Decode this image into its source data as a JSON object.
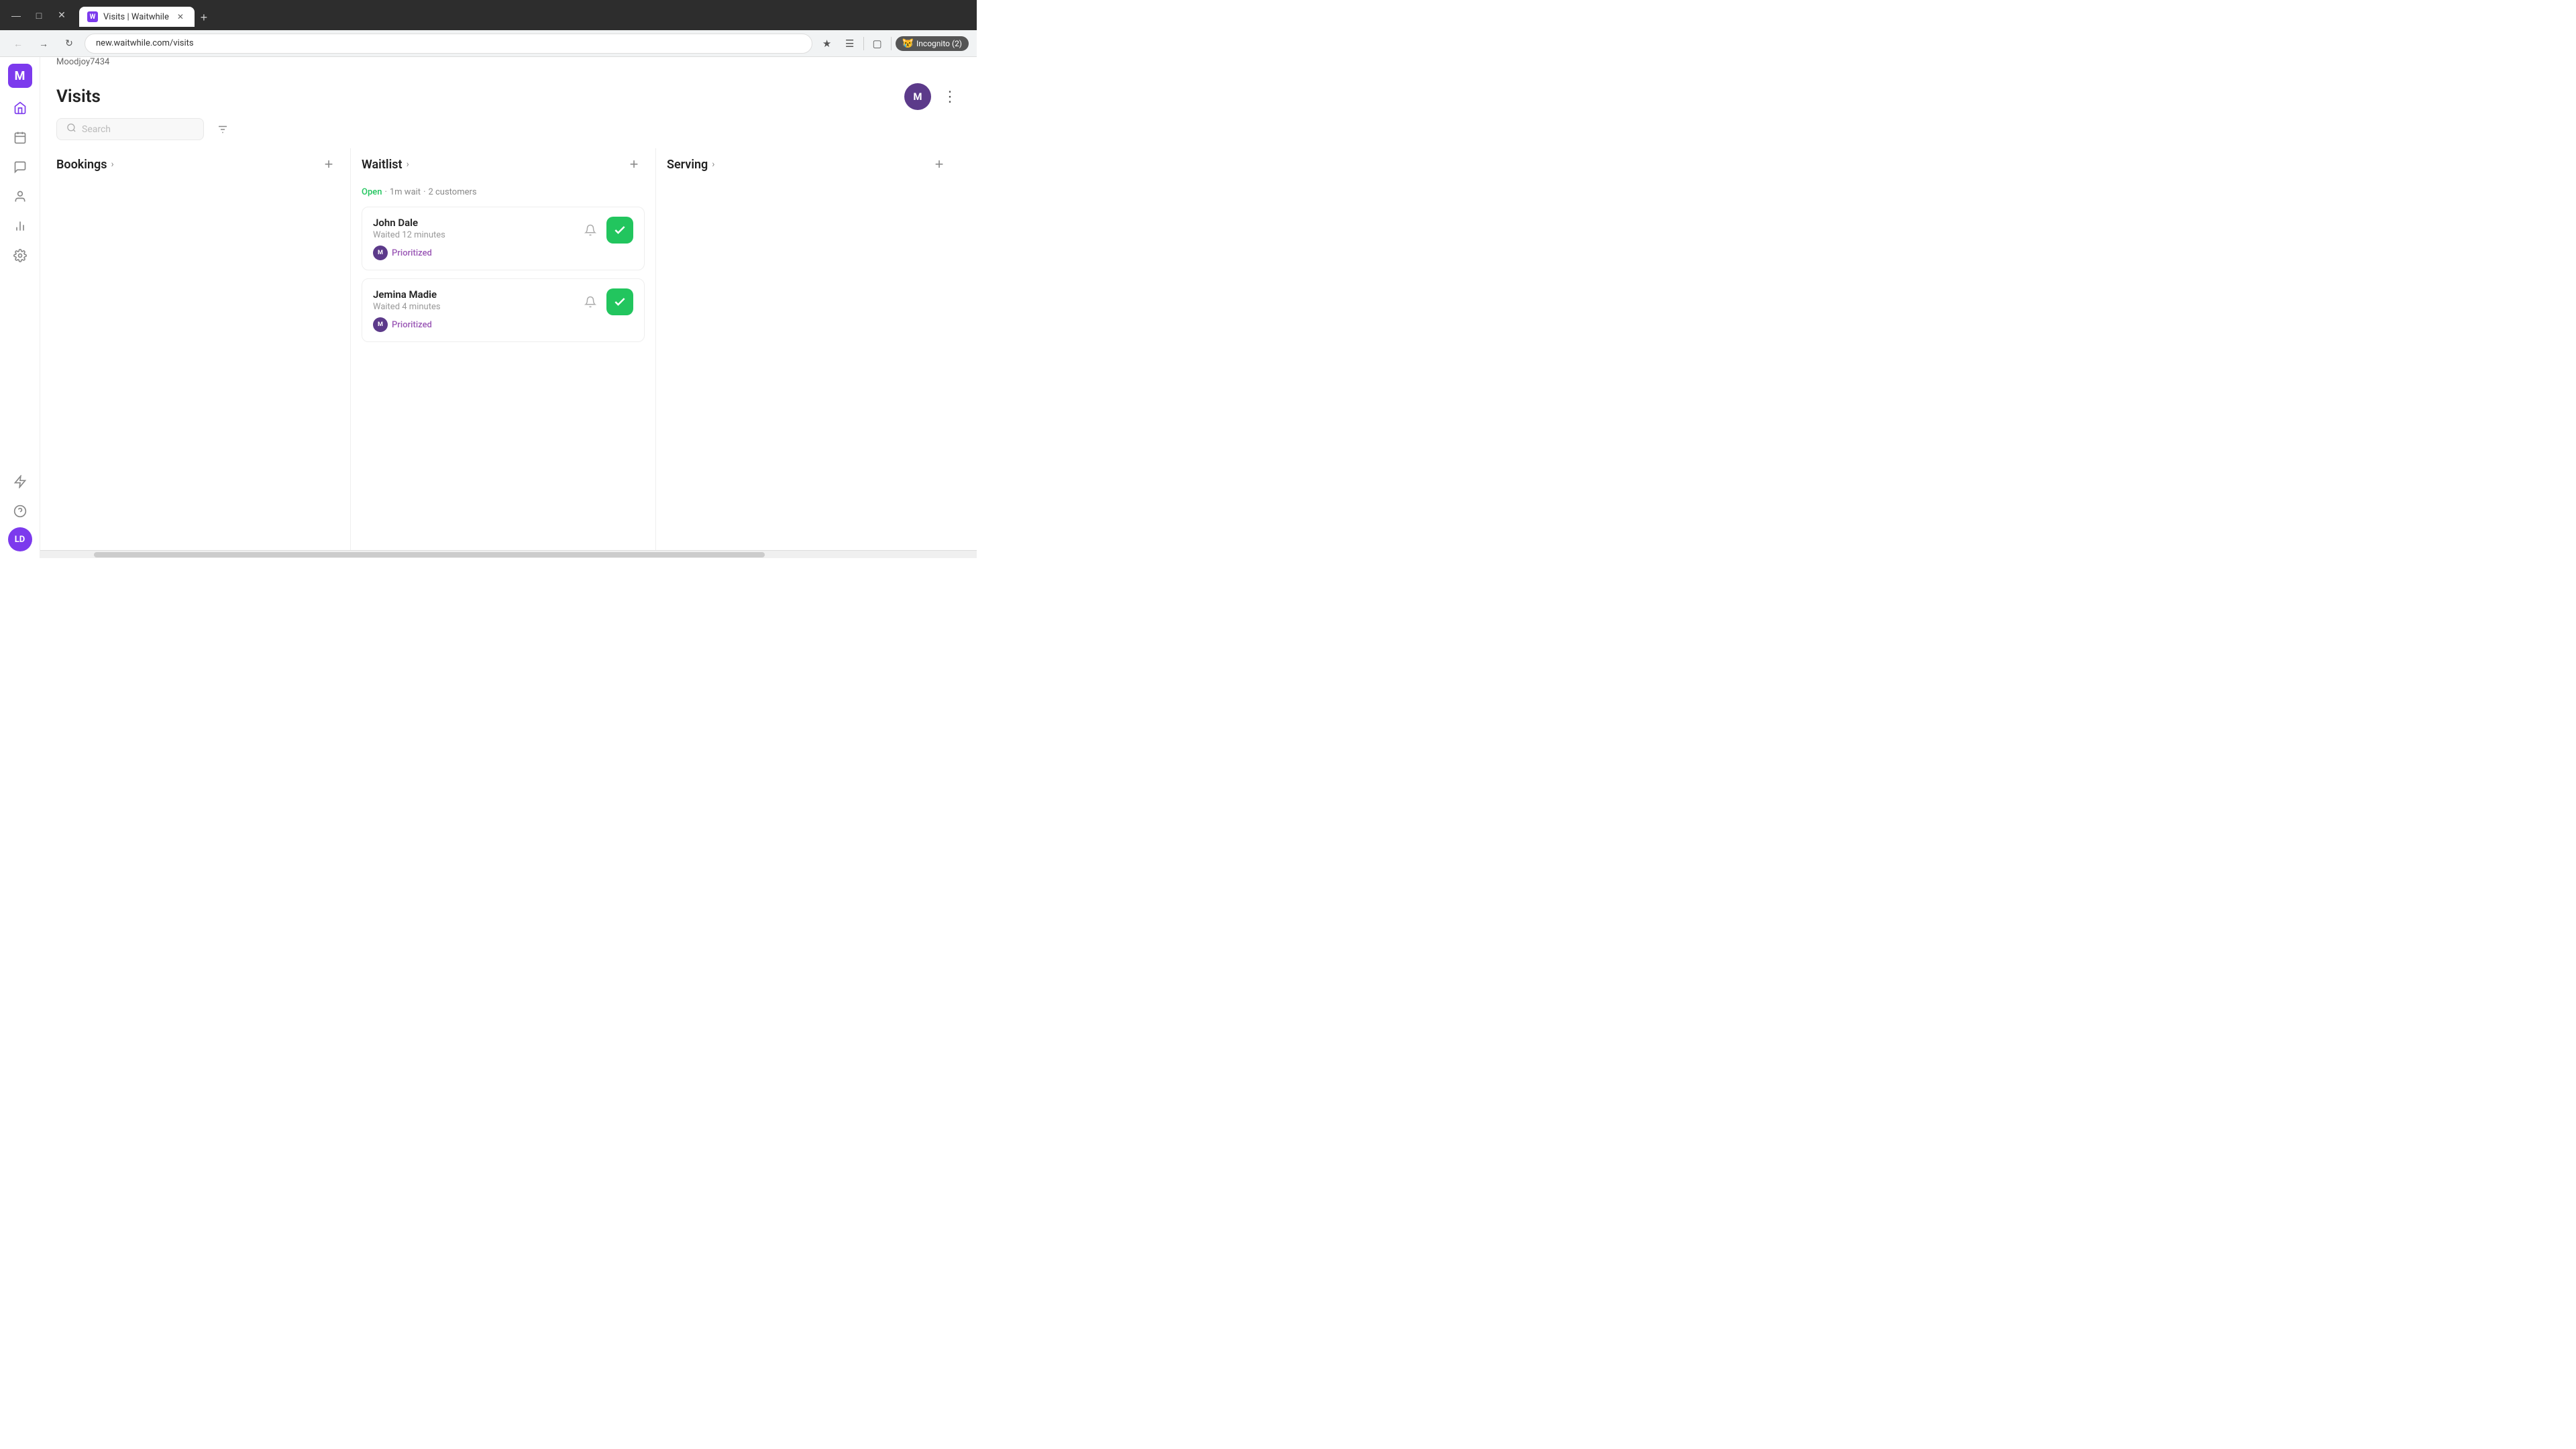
{
  "browser": {
    "tab_title": "Visits | Waitwhile",
    "tab_favicon_letter": "W",
    "url": "new.waitwhile.com/visits",
    "incognito_label": "Incognito (2)",
    "new_tab_label": "+"
  },
  "workspace": {
    "name": "Moodjoy7434",
    "logo_letter": "M"
  },
  "page": {
    "title": "Visits"
  },
  "header": {
    "user_initials": "M",
    "more_label": "⋮"
  },
  "toolbar": {
    "search_placeholder": "Search",
    "filter_icon": "≡"
  },
  "columns": [
    {
      "id": "bookings",
      "title": "Bookings",
      "has_add": true,
      "status_line": null,
      "visits": []
    },
    {
      "id": "waitlist",
      "title": "Waitlist",
      "has_add": true,
      "status_open": "Open",
      "status_wait": "1m wait",
      "status_customers": "2 customers",
      "visits": [
        {
          "name": "John Dale",
          "wait": "Waited 12 minutes",
          "tag_initials": "M",
          "tag_label": "Prioritized"
        },
        {
          "name": "Jemina Madie",
          "wait": "Waited 4 minutes",
          "tag_initials": "M",
          "tag_label": "Prioritized"
        }
      ]
    },
    {
      "id": "serving",
      "title": "Serving",
      "has_add": true,
      "status_line": null,
      "visits": []
    }
  ],
  "sidebar": {
    "items": [
      {
        "id": "home",
        "icon": "⌂",
        "label": "Home"
      },
      {
        "id": "calendar",
        "icon": "📅",
        "label": "Calendar"
      },
      {
        "id": "chat",
        "icon": "💬",
        "label": "Messages"
      },
      {
        "id": "users",
        "icon": "👤",
        "label": "Users"
      },
      {
        "id": "analytics",
        "icon": "📊",
        "label": "Analytics"
      },
      {
        "id": "settings",
        "icon": "⚙",
        "label": "Settings"
      }
    ],
    "bottom": [
      {
        "id": "flash",
        "icon": "⚡",
        "label": "Flash"
      },
      {
        "id": "help",
        "icon": "?",
        "label": "Help"
      }
    ],
    "user_initials": "LD"
  },
  "colors": {
    "purple": "#7c3aed",
    "green": "#22c55e",
    "prioritized": "#9b59b6"
  }
}
